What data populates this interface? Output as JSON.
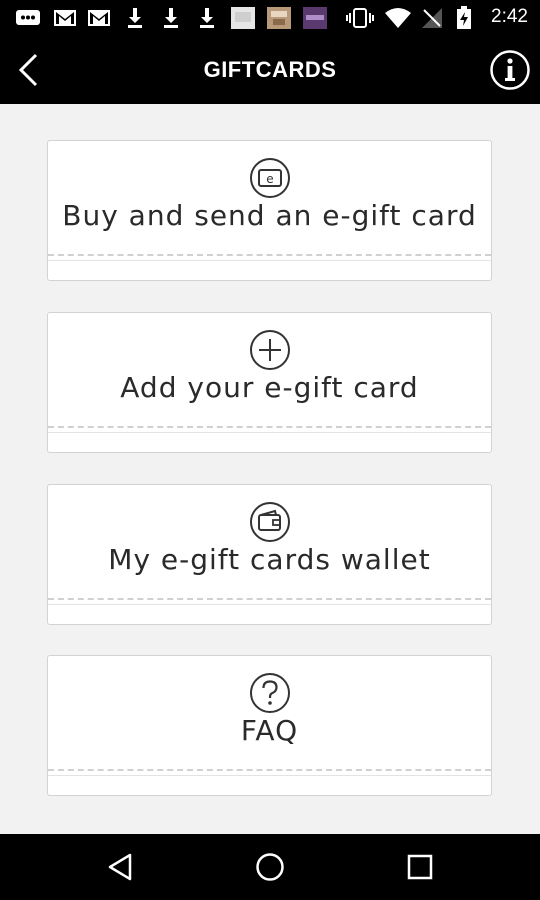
{
  "status_bar": {
    "time": "2:42",
    "icons": [
      "message-icon",
      "gmail-icon",
      "gmail-icon",
      "download-icon",
      "download-icon",
      "download-icon",
      "app-thumbnail-icon",
      "app-thumbnail-icon",
      "app-thumbnail-icon",
      "vibrate-icon",
      "wifi-icon",
      "no-signal-icon",
      "battery-charging-icon"
    ]
  },
  "header": {
    "title": "GIFTCARDS",
    "back_icon": "back-arrow-icon",
    "info_icon": "info-icon"
  },
  "menu": {
    "items": [
      {
        "label": "Buy and send an e-gift card",
        "icon": "e-card-icon"
      },
      {
        "label": "Add your e-gift card",
        "icon": "plus-circle-icon"
      },
      {
        "label": "My e-gift cards wallet",
        "icon": "wallet-icon"
      },
      {
        "label": "FAQ",
        "icon": "question-circle-icon"
      }
    ]
  },
  "nav_bar": {
    "buttons": [
      "back-triangle-icon",
      "home-circle-icon",
      "recents-square-icon"
    ]
  },
  "colors": {
    "bar_background": "#000000",
    "page_background": "#f2f2f2",
    "card_background": "#ffffff",
    "card_border": "#d3d3d3",
    "text": "#2a2a2a"
  }
}
